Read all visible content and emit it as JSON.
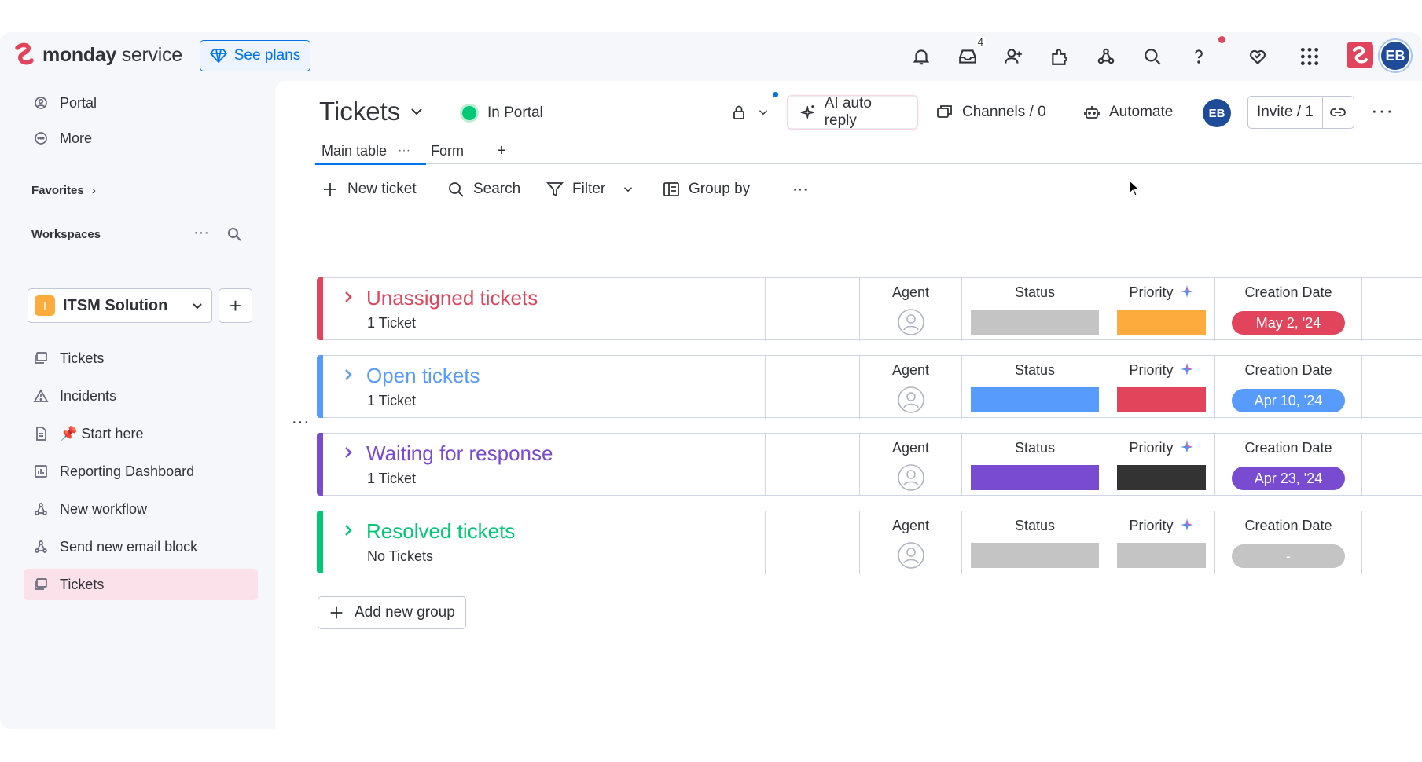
{
  "topbar": {
    "brand_bold": "monday",
    "brand_light": "service",
    "see_plans": "See plans",
    "inbox_count": "4",
    "user_initials": "EB"
  },
  "sidebar": {
    "items_top": [
      {
        "label": "Portal",
        "icon": "portal-icon"
      },
      {
        "label": "More",
        "icon": "more-icon"
      }
    ],
    "favorites": "Favorites",
    "workspaces": "Workspaces",
    "workspace_name": "ITSM Solution",
    "workspace_badge": "I",
    "items": [
      {
        "label": "Tickets",
        "icon": "board-icon"
      },
      {
        "label": "Incidents",
        "icon": "warning-icon"
      },
      {
        "label": "📌 Start here",
        "icon": "doc-icon"
      },
      {
        "label": "Reporting Dashboard",
        "icon": "dashboard-icon"
      },
      {
        "label": "New workflow",
        "icon": "workflow-icon"
      },
      {
        "label": "Send new email block",
        "icon": "workflow-icon"
      },
      {
        "label": "Tickets",
        "icon": "board-icon",
        "active": true
      }
    ]
  },
  "header": {
    "title": "Tickets",
    "portal_status": "In Portal",
    "ai_auto_reply": "AI auto reply",
    "channels": "Channels / 0",
    "automate": "Automate",
    "user_initials": "EB",
    "invite": "Invite / 1"
  },
  "tabs": [
    {
      "label": "Main table",
      "active": true
    },
    {
      "label": "Form"
    }
  ],
  "toolbar": {
    "new_ticket": "New ticket",
    "search": "Search",
    "filter": "Filter",
    "group_by": "Group by"
  },
  "columns": {
    "agent": "Agent",
    "status": "Status",
    "priority": "Priority",
    "creation_date": "Creation Date"
  },
  "groups": [
    {
      "name": "Unassigned tickets",
      "count": "1 Ticket",
      "color": "#e2445c",
      "status_color": "#c4c4c4",
      "priority_color": "#fdab3d",
      "date": "May 2, '24",
      "date_color": "#e2445c"
    },
    {
      "name": "Open tickets",
      "count": "1 Ticket",
      "color": "#579bfc",
      "status_color": "#579bfc",
      "priority_color": "#e2445c",
      "date": "Apr 10, '24",
      "date_color": "#579bfc"
    },
    {
      "name": "Waiting for response",
      "count": "1 Ticket",
      "color": "#784bd1",
      "status_color": "#784bd1",
      "priority_color": "#333333",
      "date": "Apr 23, '24",
      "date_color": "#784bd1"
    },
    {
      "name": "Resolved tickets",
      "count": "No Tickets",
      "color": "#00c875",
      "status_color": "#c4c4c4",
      "priority_color": "#c4c4c4",
      "date": "-",
      "date_color": "#c4c4c4"
    }
  ],
  "add_group": "Add new group"
}
